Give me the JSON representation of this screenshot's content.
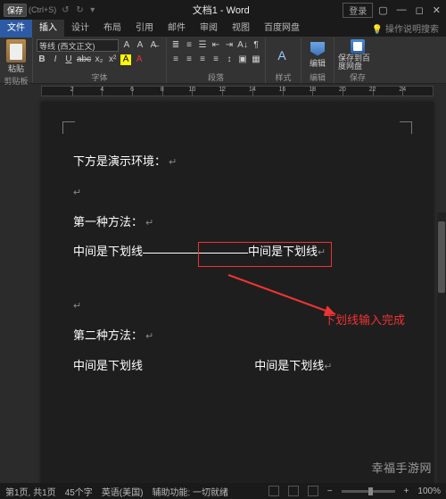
{
  "titlebar": {
    "save_btn": "保存",
    "shortcut": "(Ctrl+S)",
    "doc_title": "文档1 - Word",
    "login": "登录"
  },
  "tabs": {
    "file": "文件",
    "insert": "插入",
    "design": "设计",
    "layout": "布局",
    "references": "引用",
    "mailings": "邮件",
    "review": "审阅",
    "view": "视图",
    "baidu": "百度网盘",
    "tell_me": "操作说明搜索"
  },
  "ribbon": {
    "clipboard": {
      "label": "剪贴板",
      "paste": "粘贴"
    },
    "font": {
      "label": "字体",
      "family": "等线 (西文正文)",
      "bold": "B",
      "italic": "I",
      "underline": "U",
      "strike": "abc",
      "sub": "x₂",
      "sup": "x²",
      "highlight": "A",
      "color": "A"
    },
    "paragraph": {
      "label": "段落"
    },
    "styles": {
      "label": "样式"
    },
    "editing": {
      "label": "编辑",
      "btn": "编辑"
    },
    "save_cloud": {
      "label": "保存",
      "btn": "保存到百度网盘"
    }
  },
  "ruler_numbers": [
    "2",
    "4",
    "6",
    "8",
    "10",
    "12",
    "14",
    "16",
    "18",
    "20",
    "22",
    "24"
  ],
  "document": {
    "line1": "下方是演示环境：",
    "method1_title": "第一种方法：",
    "method1_text_left": "中间是下划线",
    "method1_text_right": "中间是下划线",
    "method2_title": "第二种方法：",
    "method2_text_left": "中间是下划线",
    "method2_text_right": "中间是下划线"
  },
  "annotation": {
    "text": "下划线输入完成",
    "box_color": "#e33"
  },
  "statusbar": {
    "page": "第1页, 共1页",
    "words": "45个字",
    "lang": "英语(美国)",
    "accessibility": "辅助功能: 一切就绪",
    "zoom_minus": "−",
    "zoom_plus": "+",
    "zoom_pct": "100%"
  },
  "watermark": "幸福手游网"
}
